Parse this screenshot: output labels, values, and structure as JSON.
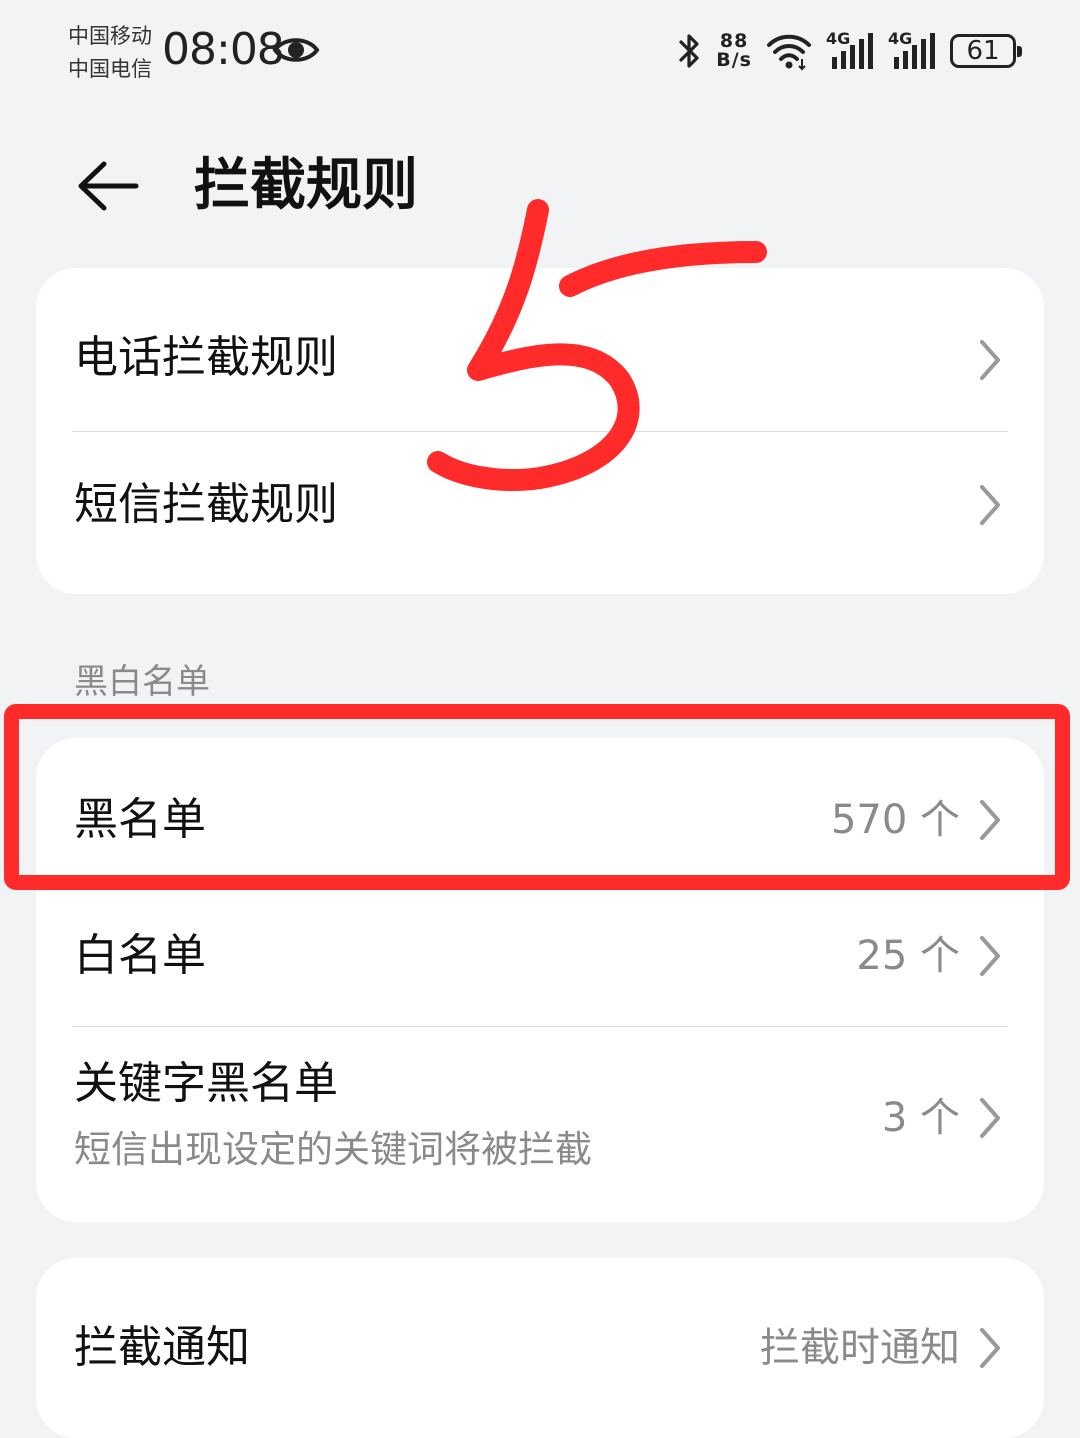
{
  "status_bar": {
    "carrier_1": "中国移动",
    "carrier_2": "中国电信",
    "time": "08:08",
    "net_speed_value": "88",
    "net_speed_unit": "B/s",
    "signal_1_label": "4G",
    "signal_2_label": "4G",
    "battery": "61",
    "icons": [
      "eye-icon",
      "bluetooth-icon",
      "wifi-icon",
      "signal-icon",
      "signal-icon",
      "battery-icon"
    ]
  },
  "header": {
    "title": "拦截规则",
    "back_icon": "back-arrow-icon"
  },
  "rules_card": {
    "items": [
      {
        "label": "电话拦截规则"
      },
      {
        "label": "短信拦截规则"
      }
    ]
  },
  "lists_section": {
    "label": "黑白名单",
    "items": [
      {
        "label": "黑名单",
        "value": "570 个"
      },
      {
        "label": "白名单",
        "value": "25 个"
      },
      {
        "label": "关键字黑名单",
        "subtitle": "短信出现设定的关键词将被拦截",
        "value": "3 个"
      }
    ]
  },
  "notify_card": {
    "label": "拦截通知",
    "value": "拦截时通知"
  },
  "annotation": {
    "color": "#ff2b2b",
    "handwritten_text": "5"
  },
  "colors": {
    "background": "#f1f3f5",
    "card": "#ffffff",
    "secondary_text": "#8a8a8a",
    "annotation": "#ff2b2b"
  }
}
